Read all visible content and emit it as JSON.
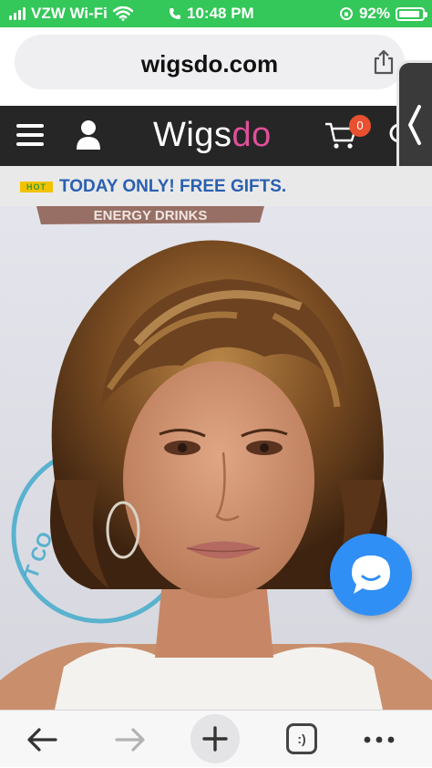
{
  "status_bar": {
    "carrier": "VZW Wi-Fi",
    "time": "10:48 PM",
    "battery_percent": "92%",
    "battery_level": 0.92,
    "color": "#34c759"
  },
  "browser": {
    "url": "wigsdo.com",
    "share_icon": "share-icon",
    "url_bar_color": "#efeff1"
  },
  "site_header": {
    "logo_main": "Wigs",
    "logo_accent": "do",
    "cart_count": "0",
    "menu_icon": "hamburger-icon",
    "user_icon": "user-icon",
    "cart_icon": "cart-icon",
    "search_icon": "search-icon",
    "side_tab_icon": "chevron-left-icon",
    "accent_color": "#e0509a",
    "background": "#262626"
  },
  "promo": {
    "badge": "HOT",
    "text": "TODAY ONLY! FREE GIFTS.",
    "text_color": "#2a5fb0"
  },
  "hero": {
    "backdrop_text": "ENERGY DRINKS",
    "backdrop_ring_text": "T CO."
  },
  "chat": {
    "icon": "chat-bubble-icon",
    "color": "#2f8ff5"
  },
  "toolbar": {
    "tabs_label": ":)",
    "back_icon": "back-arrow-icon",
    "forward_icon": "forward-arrow-icon",
    "new_tab_icon": "plus-icon",
    "tabs_icon": "tabs-icon",
    "more_icon": "more-dots-icon"
  }
}
